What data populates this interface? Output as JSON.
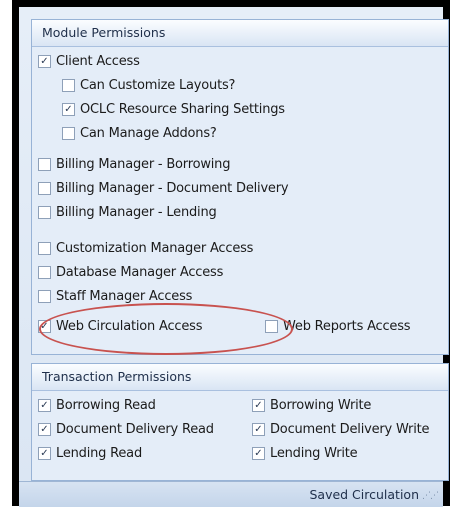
{
  "module_group": {
    "title": "Module Permissions",
    "client_access": {
      "label": "Client Access",
      "checked": true
    },
    "can_customize_layouts": {
      "label": "Can Customize Layouts?",
      "checked": false
    },
    "oclc_resource_sharing": {
      "label": "OCLC Resource Sharing Settings",
      "checked": true
    },
    "can_manage_addons": {
      "label": "Can Manage Addons?",
      "checked": false
    },
    "billing_borrowing": {
      "label": "Billing Manager - Borrowing",
      "checked": false
    },
    "billing_document_delivery": {
      "label": "Billing Manager - Document Delivery",
      "checked": false
    },
    "billing_lending": {
      "label": "Billing Manager - Lending",
      "checked": false
    },
    "customization_manager": {
      "label": "Customization Manager Access",
      "checked": false
    },
    "database_manager": {
      "label": "Database Manager Access",
      "checked": false
    },
    "staff_manager": {
      "label": "Staff Manager Access",
      "checked": false
    },
    "web_circulation": {
      "label": "Web Circulation Access",
      "checked": true
    },
    "web_reports": {
      "label": "Web Reports Access",
      "checked": false
    }
  },
  "transaction_group": {
    "title": "Transaction Permissions",
    "borrowing_read": {
      "label": "Borrowing Read",
      "checked": true
    },
    "borrowing_write": {
      "label": "Borrowing Write",
      "checked": true
    },
    "document_delivery_read": {
      "label": "Document Delivery Read",
      "checked": true
    },
    "document_delivery_write": {
      "label": "Document Delivery Write",
      "checked": true
    },
    "lending_read": {
      "label": "Lending Read",
      "checked": true
    },
    "lending_write": {
      "label": "Lending Write",
      "checked": true
    }
  },
  "status_bar": {
    "text": "Saved Circulation"
  },
  "colors": {
    "highlight_circle": "#c8524f",
    "group_border": "#98b3d6",
    "panel_bg": "#e4edf8"
  }
}
